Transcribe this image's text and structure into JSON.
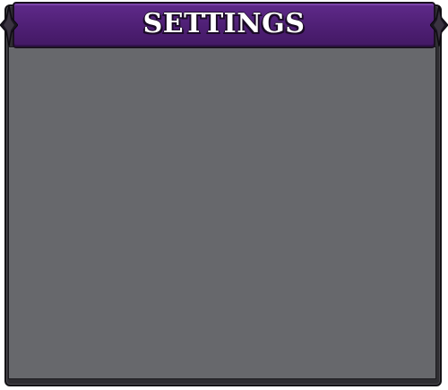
{
  "settings_panel": {
    "title": "SETTINGS",
    "colors": {
      "header_purple": "#4e1f74",
      "frame_dark": "#2e2d31",
      "content_gray": "#67686c",
      "title_text": "#ffffff"
    },
    "icons": {
      "left_ornament": "spiked-ornament-icon",
      "right_ornament": "spiked-ornament-icon"
    }
  }
}
